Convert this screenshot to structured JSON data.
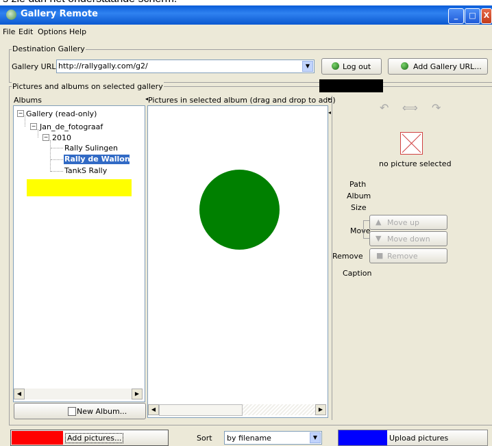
{
  "caption_top": "s zie dan het onderstaande scherm:",
  "window": {
    "title": "Gallery Remote"
  },
  "menu": [
    "File",
    "Edit",
    "Options",
    "Help"
  ],
  "destination": {
    "legend": "Destination Gallery",
    "url_label": "Gallery URL",
    "url_value": "http://rallygally.com/g2/",
    "logout_label": "Log out",
    "add_url_label": "Add Gallery URL..."
  },
  "pictures_section": {
    "legend": "Pictures and albums on selected gallery"
  },
  "albums": {
    "header": "Albums",
    "tree": [
      "Gallery (read-only)",
      "Jan_de_fotograaf",
      "2010",
      "Rally Sulingen",
      "Rally de Wallonie",
      "TankS Rally"
    ],
    "new_album_label": "New Album..."
  },
  "pictures_panel": {
    "header": "Pictures in selected album (drag and drop to add)"
  },
  "details": {
    "no_picture": "no picture selected",
    "path_label": "Path",
    "album_label": "Album",
    "size_label": "Size",
    "move_label": "Move",
    "move_up": "Move up",
    "move_down": "Move down",
    "remove_label": "Remove",
    "remove_button": "Remove",
    "caption_label": "Caption"
  },
  "bottom": {
    "add_pictures": "Add pictures...",
    "sort_label": "Sort",
    "sort_value": "by filename",
    "upload": "Upload pictures"
  },
  "colors": {
    "redaction_black": "#000000",
    "highlight_yellow": "#ffff00",
    "circle_green": "#008000",
    "marker_red": "#ff0000",
    "marker_blue": "#0000ff",
    "selection_blue": "#316ac5"
  }
}
